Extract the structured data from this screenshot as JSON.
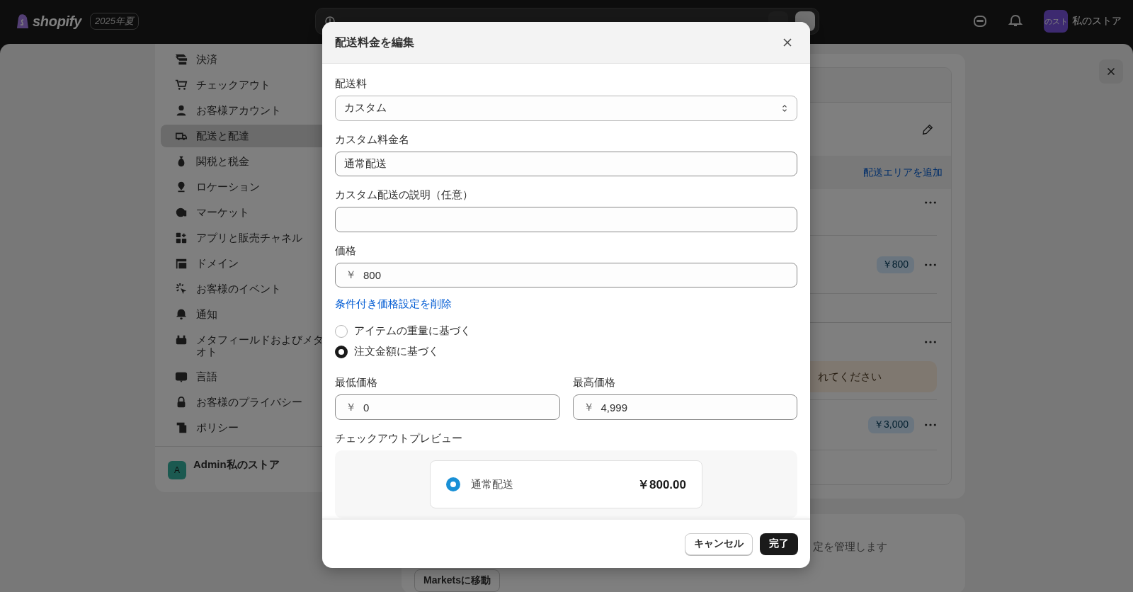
{
  "top_bar": {
    "logo": "shopify",
    "edition": "2025年夏",
    "avatar": "のスト",
    "store": "私のストア"
  },
  "sidebar": {
    "items": [
      {
        "label": "決済",
        "selected": false
      },
      {
        "label": "チェックアウト",
        "selected": false
      },
      {
        "label": "お客様アカウント",
        "selected": false
      },
      {
        "label": "配送と配達",
        "selected": true
      },
      {
        "label": "関税と税金",
        "selected": false
      },
      {
        "label": "ロケーション",
        "selected": false
      },
      {
        "label": "マーケット",
        "selected": false
      },
      {
        "label": "アプリと販売チャネル",
        "selected": false
      },
      {
        "label": "ドメイン",
        "selected": false
      },
      {
        "label": "お客様のイベント",
        "selected": false
      },
      {
        "label": "通知",
        "selected": false
      },
      {
        "label": "メタフィールドおよびメタオト",
        "selected": false
      },
      {
        "label": "言語",
        "selected": false
      },
      {
        "label": "お客様のプライバシー",
        "selected": false
      },
      {
        "label": "ポリシー",
        "selected": false
      }
    ],
    "account": {
      "avatar": "A",
      "name": "Admin私のストア"
    }
  },
  "background": {
    "add_zone_link": "配送エリアを追加",
    "first_rate_price": "￥800",
    "warning": "れてください",
    "second_rate_price": "￥3,000",
    "markets_text": "定を管理します",
    "markets_button": "Marketsに移動"
  },
  "modal": {
    "title": "配送料金を編集",
    "rate_type": {
      "label": "配送料",
      "value": "カスタム"
    },
    "rate_name": {
      "label": "カスタム料金名",
      "value": "通常配送"
    },
    "description": {
      "label": "カスタム配送の説明（任意）"
    },
    "price": {
      "label": "価格",
      "prefix": "￥",
      "value": "800"
    },
    "remove_link": "条件付き価格設定を削除",
    "conditions": [
      {
        "label": "アイテムの重量に基づく",
        "selected": false
      },
      {
        "label": "注文金額に基づく",
        "selected": true
      }
    ],
    "min_price": {
      "label": "最低価格",
      "prefix": "￥",
      "value": "0"
    },
    "max_price": {
      "label": "最高価格",
      "prefix": "￥",
      "value": "4,999"
    },
    "preview": {
      "label": "チェックアウトプレビュー",
      "name": "通常配送",
      "price": "￥800.00",
      "selected": true
    },
    "buttons": {
      "cancel": "キャンセル",
      "done": "完了"
    }
  }
}
